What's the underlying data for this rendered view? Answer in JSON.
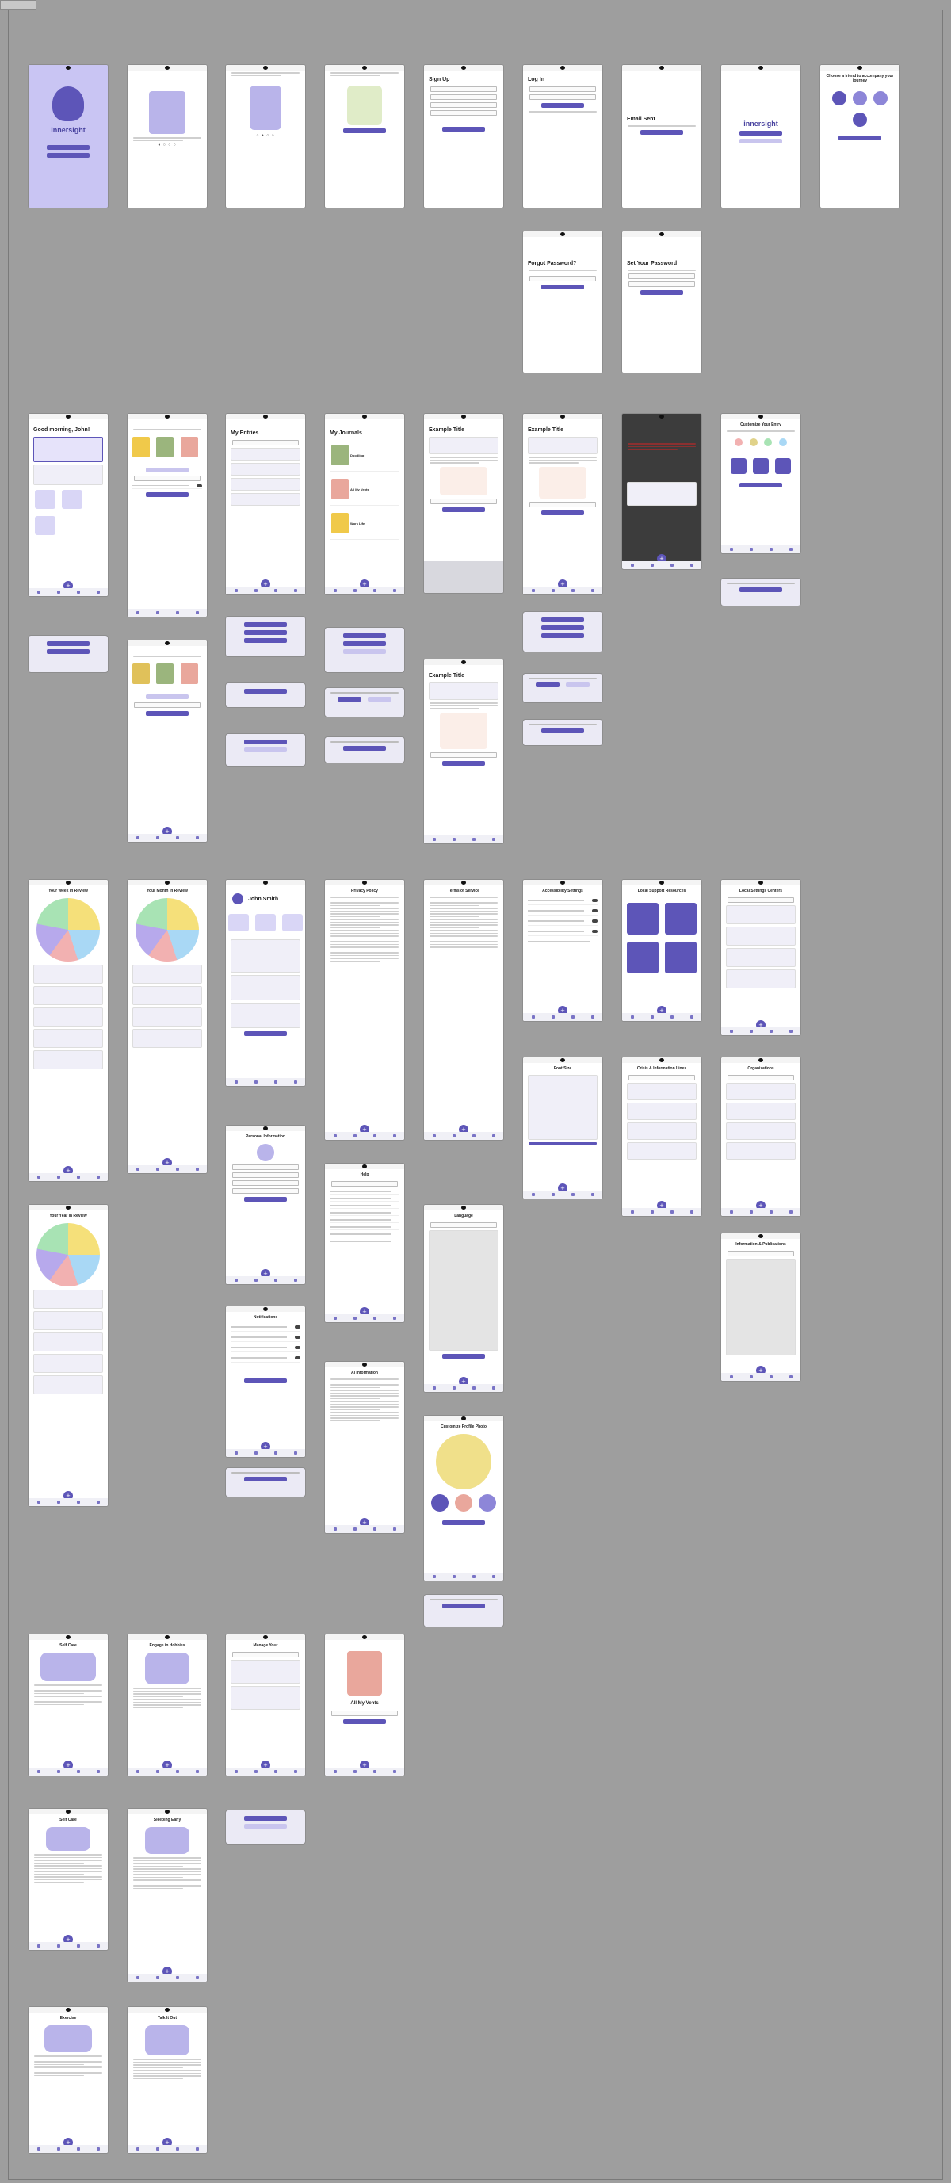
{
  "app": {
    "name": "innersight",
    "accent": "#5d55b8",
    "accent_light": "#c9c5ee",
    "canvas_bg": "#9e9e9e"
  },
  "icons": [
    "status-notch-icon",
    "battery-icon",
    "home-icon",
    "plus-icon",
    "journal-icon",
    "profile-icon",
    "chevron-icon"
  ],
  "onboarding": {
    "splash": {
      "logo": "innersight"
    },
    "sign_up": {
      "title": "Sign Up"
    },
    "log_in": {
      "title": "Log In"
    },
    "email_sent": {
      "title": "Email Sent"
    },
    "choose_friend": {
      "title": "Choose a friend to accompany your journey"
    },
    "forgot_password": {
      "title": "Forgot Password?"
    },
    "set_password": {
      "title": "Set Your Password"
    }
  },
  "journaling": {
    "home": {
      "greeting": "Good morning, John!"
    },
    "entries": {
      "title": "My Entries"
    },
    "journals": {
      "title": "My Journals",
      "items": [
        "Doodling",
        "All My Vents",
        "Work Life"
      ]
    },
    "entry": {
      "title": "Example Title"
    },
    "customize": {
      "title": "Customize Your Entry"
    }
  },
  "insights": {
    "week": {
      "title": "Your Week in Review"
    },
    "month": {
      "title": "Your Month in Review"
    },
    "year": {
      "title": "Your Year in Review"
    }
  },
  "profile": {
    "name": "John Smith",
    "personal_info": {
      "title": "Personal Information"
    },
    "notifications": {
      "title": "Notifications"
    },
    "help": {
      "title": "Help"
    },
    "ai_info": {
      "title": "AI Information"
    },
    "privacy": {
      "title": "Privacy Policy"
    },
    "terms": {
      "title": "Terms of Service"
    },
    "language": {
      "title": "Language"
    },
    "profile_photo": {
      "title": "Customize Profile Photo"
    },
    "accessibility": {
      "title": "Accessibility Settings"
    }
  },
  "support": {
    "crisis": {
      "title": "Local Support Resources"
    },
    "local_settings": {
      "title": "Local Settings Centers"
    },
    "crisis_lines": {
      "title": "Crisis & Information Lines"
    },
    "organizations": {
      "title": "Organizations"
    },
    "info_pubs": {
      "title": "Information & Publications"
    },
    "font_size": {
      "title": "Font Size"
    }
  },
  "self_care": {
    "self_care": {
      "title": "Self Care"
    },
    "engage": {
      "title": "Engage in Hobbies"
    },
    "manage": {
      "title": "Manage Your"
    },
    "vents": {
      "title": "All My Vents"
    },
    "sleep": {
      "title": "Sleeping Early"
    },
    "exercise": {
      "title": "Exercise"
    },
    "talk": {
      "title": "Talk It Out"
    }
  }
}
